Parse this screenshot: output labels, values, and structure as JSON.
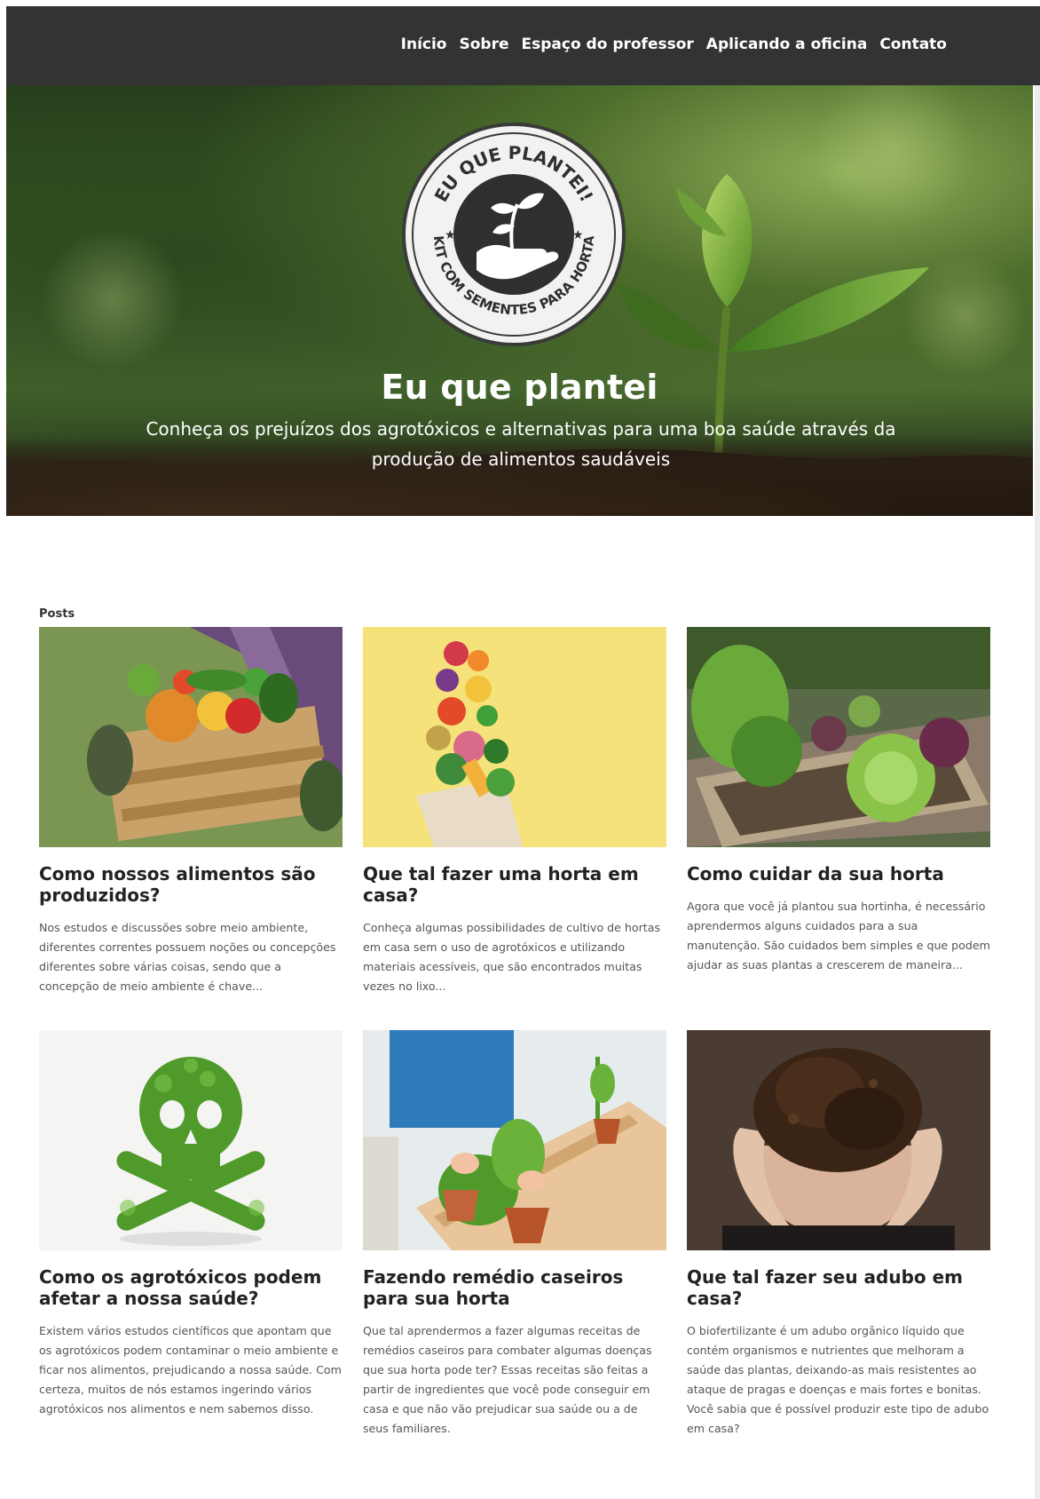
{
  "nav": {
    "items": [
      {
        "label": "Início"
      },
      {
        "label": "Sobre"
      },
      {
        "label": "Espaço do professor"
      },
      {
        "label": "Aplicando a oficina"
      },
      {
        "label": "Contato"
      }
    ]
  },
  "hero": {
    "logo_text_top": "EU QUE PLANTEI!",
    "logo_text_bottom": "KIT COM SEMENTES PARA HORTA",
    "title": "Eu que plantei",
    "subtitle": "Conheça os prejuízos dos agrotóxicos e alternativas para uma boa saúde através da produção de alimentos saudáveis"
  },
  "posts": {
    "label": "Posts",
    "items": [
      {
        "title": "Como nossos alimentos são produzidos?",
        "excerpt": "Nos estudos e discussões sobre meio ambiente, diferentes correntes possuem noções ou concepções diferentes sobre várias coisas, sendo que a concepção de meio ambiente é chave...",
        "image": "vegetable-crate-image"
      },
      {
        "title": "Que tal fazer uma horta em casa?",
        "excerpt": "Conheça algumas possibilidades de cultivo de hortas em casa sem o uso de agrotóxicos e utilizando materiais acessíveis, que são encontrados muitas vezes no lixo...",
        "image": "food-bag-image"
      },
      {
        "title": "Como cuidar da sua horta",
        "excerpt": "Agora que você já plantou sua hortinha, é necessário aprendermos alguns cuidados para a sua manutenção. São cuidados bem simples e que podem ajudar as suas plantas a crescerem de maneira...",
        "image": "garden-bed-image"
      },
      {
        "title": "Como os agrotóxicos podem afetar a nossa saúde?",
        "excerpt": "Existem vários estudos científicos que apontam que os agrotóxicos podem contaminar o meio ambiente e ficar nos alimentos, prejudicando a nossa saúde. Com certeza, muitos de nós estamos ingerindo vários agrotóxicos nos alimentos e nem sabemos disso.",
        "image": "leaf-skull-image"
      },
      {
        "title": "Fazendo remédio caseiros para sua horta",
        "excerpt": "Que tal aprendermos a fazer algumas receitas de remédios caseiros para combater algumas doenças que sua horta pode ter? Essas receitas são feitas a partir de ingredientes que você pode conseguir em casa e que não vão prejudicar sua saúde ou a de seus familiares.",
        "image": "potted-plants-image"
      },
      {
        "title": "Que tal fazer seu adubo em casa?",
        "excerpt": "O biofertilizante é um adubo orgânico líquido que contém organismos e nutrientes que melhoram a saúde das plantas, deixando-as mais resistentes ao ataque de pragas e doenças e mais fortes e bonitas. Você sabia que é possível produzir este tipo de adubo em casa?",
        "image": "soil-hands-image"
      }
    ]
  },
  "colors": {
    "navbar": "#333333",
    "text": "#222222",
    "muted": "#555555"
  }
}
